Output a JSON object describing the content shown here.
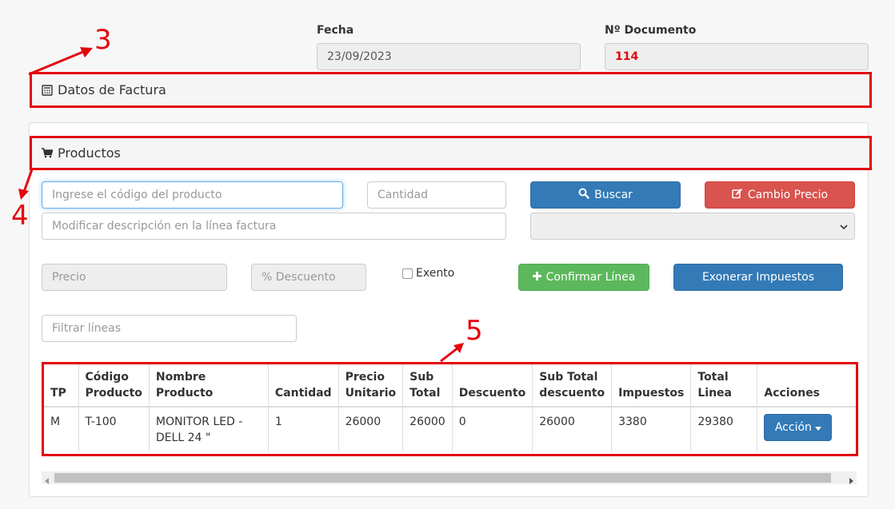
{
  "header": {
    "fecha_label": "Fecha",
    "fecha_value": "23/09/2023",
    "documento_label": "Nº Documento",
    "documento_value": "114"
  },
  "sections": {
    "factura_title": "Datos de Factura",
    "productos_title": "Productos"
  },
  "form": {
    "codigo_placeholder": "Ingrese el código del producto",
    "cantidad_placeholder": "Cantidad",
    "descripcion_placeholder": "Modificar descripción en la línea factura",
    "precio_placeholder": "Precio",
    "descuento_placeholder": "% Descuento",
    "exento_label": "Exento",
    "filtrar_placeholder": "Filtrar líneas"
  },
  "buttons": {
    "buscar": "Buscar",
    "cambio_precio": "Cambio Precio",
    "confirmar_linea": "Confirmar Línea",
    "exonerar": "Exonerar Impuestos",
    "accion": "Acción"
  },
  "annotations": {
    "a3": "3",
    "a4": "4",
    "a5": "5"
  },
  "table": {
    "headers": {
      "tp": "TP",
      "codigo_l1": "Código",
      "codigo_l2": "Producto",
      "nombre": "Nombre Producto",
      "cantidad": "Cantidad",
      "precio_l1": "Precio",
      "precio_l2": "Unitario",
      "subtotal_l1": "Sub",
      "subtotal_l2": "Total",
      "descuento": "Descuento",
      "subtotaldesc_l1": "Sub Total",
      "subtotaldesc_l2": "descuento",
      "impuestos": "Impuestos",
      "totallinea_l1": "Total",
      "totallinea_l2": "Linea",
      "acciones": "Acciones"
    },
    "row": {
      "tp": "M",
      "codigo": "T-100",
      "nombre": "MONITOR LED - DELL 24 \"",
      "cantidad": "1",
      "precio": "26000",
      "subtotal": "26000",
      "descuento": "0",
      "subtotaldesc": "26000",
      "impuestos": "3380",
      "total": "29380"
    }
  },
  "colors": {
    "annotation": "#e3060d",
    "primary": "#337ab7",
    "danger": "#d9534f",
    "success": "#5cb85c"
  }
}
